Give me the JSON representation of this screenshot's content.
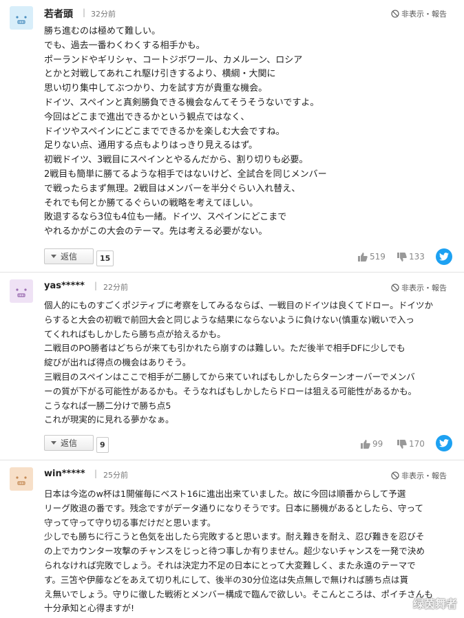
{
  "comments": [
    {
      "username": "若者頭",
      "time": "32分前",
      "hide_label": "非表示・報告",
      "lines": [
        "勝ち進むのは極めて難しい。",
        "でも、過去一番わくわくする相手かも。",
        "ポーランドやギリシャ、コートジボワール、カメルーン、ロシア",
        "とかと対戦してあれこれ駆け引きするより、横綱・大関に",
        "思い切り集中してぶつかり、力を試す方が貴重な機会。",
        "ドイツ、スペインと真剣勝負できる機会なんてそうそうないですよ。",
        "今回はどこまで進出できるかという観点ではなく、",
        "ドイツやスペインにどこまでできるかを楽しむ大会ですね。",
        "足りない点、通用する点もよりはっきり見えるはず。",
        "初戦ドイツ、3戦目にスペインとやるんだから、割り切りも必要。",
        "2戦目も簡単に勝てるような相手ではないけど、全試合を同じメンバー",
        "で戦ったらまず無理。2戦目はメンバーを半分ぐらい入れ替え、",
        "それでも何とか勝てるぐらいの戦略を考えてほしい。",
        "敗退するなら3位も4位も一緒。ドイツ、スペインにどこまで",
        "やれるかがこの大会のテーマ。先は考える必要がない。"
      ],
      "reply_label": "返信",
      "reply_count": "15",
      "likes": "519",
      "dislikes": "133"
    },
    {
      "username": "yas*****",
      "time": "22分前",
      "hide_label": "非表示・報告",
      "lines": [
        "個人的にものすごくポジティブに考察をしてみるならば、一戦目のドイツは良くてドロー。ドイツか",
        "らすると大会の初戦で前回大会と同じような結果にならないように負けない(慎重な)戦いで入っ",
        "てくれればもしかしたら勝ち点が拾えるかも。",
        "二戦目のPO勝者はどちらが来ても引かれたら崩すのは難しい。ただ後半で相手DFに少しでも",
        "綻びが出れば得点の機会はありそう。",
        "三戦目のスペインはここで相手が二勝してから来ていればもしかしたらターンオーバーでメンバ",
        "ーの質が下がる可能性があるかも。そうなればもしかしたらドローは狙える可能性があるかも。",
        "こうなれば一勝二分けで勝ち点5",
        "これが現実的に見れる夢かなぁ。"
      ],
      "reply_label": "返信",
      "reply_count": "9",
      "likes": "99",
      "dislikes": "170"
    },
    {
      "username": "win*****",
      "time": "25分前",
      "hide_label": "非表示・報告",
      "lines": [
        "日本は今迄のw杯は1開催毎にベスト16に進出出来ていました。故に今回は順番からして予選",
        "リーグ敗退の番です。残念ですがデータ通りになりそうです。日本に勝機があるとしたら、守って",
        "守って守って守り切る事だけだと思います。",
        "少しでも勝ちに行こうと色気を出したら完敗すると思います。耐え難きを耐え、忍び難きを忍びそ",
        "の上でカウンター攻撃のチャンスをじっと待つ事しか有りません。超少ないチャンスを一発で決め",
        "られなければ完敗でしょう。それは決定力不足の日本にとって大変難しく、また永遠のテーマで",
        "す。三笘や伊藤などをあえて切り札にして、後半の30分位迄は失点無しで無ければ勝ち点は貰",
        "え無いでしょう。守りに徹した戦術とメンバー構成で臨んで欲しい。そこんところは、ポイチさんも",
        "十分承知と心得ますが!"
      ]
    }
  ],
  "watermark": "绿茵舞者",
  "colors": {
    "twitter": "#1da1f2",
    "avatar1": "#d8eefa",
    "avatar2": "#efe2f5",
    "avatar3": "#f7dfc8"
  },
  "icons": [
    "ban-icon",
    "thumbs-up-icon",
    "thumbs-down-icon",
    "twitter-icon"
  ]
}
